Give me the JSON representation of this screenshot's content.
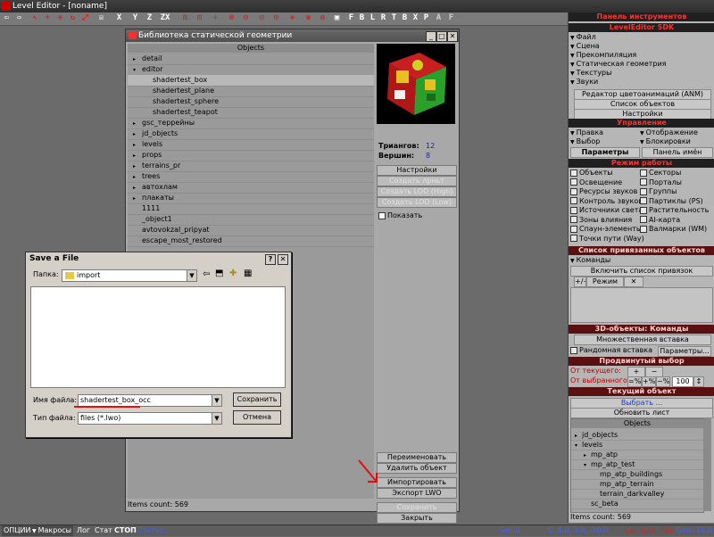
{
  "app": {
    "title": "Level Editor - [noname]"
  },
  "toolbar": {
    "xyz": [
      "X",
      "Y",
      "Z",
      "ZX"
    ],
    "snaps": [
      "F",
      "B",
      "L",
      "R",
      "T",
      "B",
      "X",
      "P",
      "A",
      "F"
    ]
  },
  "library": {
    "title": "Библиотека статической геометрии",
    "tree_header": "Objects",
    "items": [
      {
        "label": "detail",
        "indent": 1,
        "expanded": false,
        "selected": false
      },
      {
        "label": "editor",
        "indent": 1,
        "expanded": true,
        "selected": false
      },
      {
        "label": "shadertest_box",
        "indent": 3,
        "expanded": null,
        "selected": true
      },
      {
        "label": "shadertest_plane",
        "indent": 3,
        "expanded": null,
        "selected": false
      },
      {
        "label": "shadertest_sphere",
        "indent": 3,
        "expanded": null,
        "selected": false
      },
      {
        "label": "shadertest_teapot",
        "indent": 3,
        "expanded": null,
        "selected": false
      },
      {
        "label": "gsc_террейны",
        "indent": 1,
        "expanded": false,
        "selected": false
      },
      {
        "label": "jd_objects",
        "indent": 1,
        "expanded": false,
        "selected": false
      },
      {
        "label": "levels",
        "indent": 1,
        "expanded": false,
        "selected": false
      },
      {
        "label": "props",
        "indent": 1,
        "expanded": false,
        "selected": false
      },
      {
        "label": "terrains_pr",
        "indent": 1,
        "expanded": false,
        "selected": false
      },
      {
        "label": "trees",
        "indent": 1,
        "expanded": false,
        "selected": false
      },
      {
        "label": "автохлам",
        "indent": 1,
        "expanded": false,
        "selected": false
      },
      {
        "label": "плакаты",
        "indent": 1,
        "expanded": false,
        "selected": false
      },
      {
        "label": "1111",
        "indent": 1,
        "expanded": null,
        "selected": false
      },
      {
        "label": "_object1",
        "indent": 1,
        "expanded": null,
        "selected": false
      },
      {
        "label": "avtovokzal_pripyat",
        "indent": 1,
        "expanded": null,
        "selected": false
      },
      {
        "label": "escape_most_restored",
        "indent": 1,
        "expanded": null,
        "selected": false
      }
    ],
    "triangles_label": "Триангов:",
    "triangles_value": "12",
    "vertices_label": "Вершин:",
    "vertices_value": "8",
    "settings_button": "Настройки",
    "disabled_buttons": [
      "Создать лрньт",
      "Создать LOD (High)",
      "Создать LOD (Low)"
    ],
    "show_checkbox": "Показать",
    "bottom_buttons": [
      "Переименовать",
      "Удалить объект",
      "Импортировать",
      "Экспорт LWO",
      "Сохранить",
      "Закрыть"
    ],
    "items_count": "Items count: 569"
  },
  "save_dialog": {
    "title": "Save a File",
    "folder_label": "Папка:",
    "folder_value": "import",
    "filename_label": "Имя файла:",
    "filename_value": "shadertest_box_occ",
    "filetype_label": "Тип файла:",
    "filetype_value": "files (*.lwo)",
    "save_button": "Сохранить",
    "cancel_button": "Отмена"
  },
  "right_panel": {
    "title": "Панель инструментов",
    "sdk_header": "LevelEditor SDK",
    "sdk_items": [
      "Файл",
      "Сцена",
      "Прекомпиляция",
      "Статическая геометрия",
      "Текстуры",
      "Звуки"
    ],
    "tool_buttons": [
      "Редактор цветоанимаций (ANM)",
      "Список объектов",
      "Настройки"
    ],
    "control_header": "Управление",
    "control_left": [
      "Правка",
      "Выбор"
    ],
    "control_right": [
      "Отображение",
      "Блокировки"
    ],
    "tabs": [
      "Параметры",
      "Панель имён"
    ],
    "mode_header": "Режим работы",
    "modes_left": [
      "Объекты",
      "Освещение",
      "Ресурсы звуков",
      "Контроль звуков",
      "Источники света",
      "Зоны влияния",
      "Спаун-элементы",
      "Точки пути (Way)"
    ],
    "modes_right": [
      "Секторы",
      "Порталы",
      "Группы",
      "Партиклы (PS)",
      "Растительность",
      "AI-карта",
      "Валмарки (WM)"
    ],
    "snap_header": "Список привязанных объектов",
    "snap_commands": "Команды",
    "snap_enable": "Включить список привязок",
    "snap_mode": [
      "+/−",
      "Режим",
      "✕"
    ],
    "obj3d_header": "3D-объекты: Команды",
    "multi_insert": "Множественная вставка",
    "random_insert": "Рандомная вставка",
    "random_params": "Параметры...",
    "advsel_header": "Продвинутый выбор",
    "from_current": "От текущего:",
    "from_selected": "От выбранного:",
    "current_buttons": [
      "+",
      "−"
    ],
    "selected_buttons": [
      "=%",
      "+%",
      "−%"
    ],
    "selected_value": "100",
    "curobj_header": "Текущий объект",
    "select_button": "Выбрать ...",
    "refresh_button": "Обновить лист",
    "objects_header": "Objects",
    "objects_tree": [
      {
        "label": "jd_objects",
        "indent": 0,
        "marker": "▸"
      },
      {
        "label": "levels",
        "indent": 0,
        "marker": "▾"
      },
      {
        "label": "mp_atp",
        "indent": 1,
        "marker": "▸"
      },
      {
        "label": "mp_atp_test",
        "indent": 1,
        "marker": "▾"
      },
      {
        "label": "mp_atp_buildings",
        "indent": 2,
        "marker": ""
      },
      {
        "label": "mp_atp_terrain",
        "indent": 2,
        "marker": ""
      },
      {
        "label": "terrain_darkvalley",
        "indent": 2,
        "marker": ""
      },
      {
        "label": "sc_beta",
        "indent": 1,
        "marker": ""
      }
    ],
    "items_count": "Items count: 569"
  },
  "statusbar": {
    "options": "ОПЦИИ",
    "macros": "Макросы",
    "log": "Лог",
    "stat": "Стат",
    "stop": "СТОП",
    "status": "Статус:",
    "sel": "Sel: 0",
    "c": "C: 0.0, 3.0, -10.0",
    "cur": "Cur: 675, 769",
    "grid": "Grid: 10.0"
  },
  "colors": {
    "accent_red": "#e02020",
    "header_bg": "#202020",
    "annotation_red": "#e01010"
  }
}
